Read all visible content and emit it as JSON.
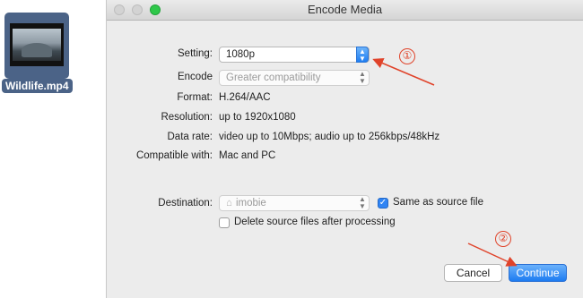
{
  "desktop": {
    "file_name": "Wildlife.mp4"
  },
  "window": {
    "title": "Encode Media"
  },
  "form": {
    "setting_label": "Setting:",
    "setting_value": "1080p",
    "encode_label": "Encode",
    "encode_value": "Greater compatibility",
    "format_label": "Format:",
    "format_value": "H.264/AAC",
    "resolution_label": "Resolution:",
    "resolution_value": "up to 1920x1080",
    "datarate_label": "Data rate:",
    "datarate_value": "video up to 10Mbps; audio up to 256kbps/48kHz",
    "compatible_label": "Compatible with:",
    "compatible_value": "Mac and PC",
    "destination_label": "Destination:",
    "destination_value": "imobie",
    "same_as_source_label": "Same as source file",
    "same_as_source_checked": true,
    "delete_source_label": "Delete source files after processing",
    "delete_source_checked": false
  },
  "buttons": {
    "cancel": "Cancel",
    "continue": "Continue"
  },
  "annotations": {
    "step1": "①",
    "step2": "②",
    "color": "#e0432a"
  }
}
